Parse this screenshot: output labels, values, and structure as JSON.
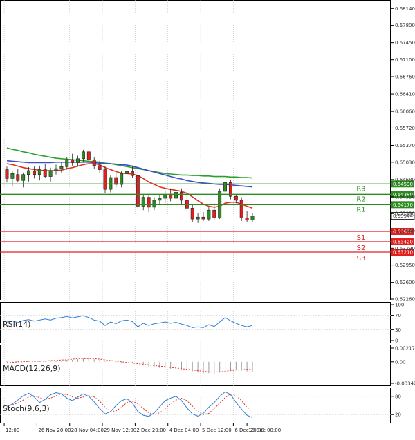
{
  "chart_data": [
    {
      "type": "candlestick",
      "name": "price",
      "ylim": [
        0.6226,
        0.682
      ],
      "y_ticks": [
        "0.68140",
        "0.67800",
        "0.67450",
        "0.67100",
        "0.66760",
        "0.66410",
        "0.66060",
        "0.65720",
        "0.65370",
        "0.65030",
        "0.64680",
        "0.64330",
        "0.63990",
        "0.63640",
        "0.63290",
        "0.62950",
        "0.62600",
        "0.62260"
      ],
      "x_ticks": [
        "12:00",
        "26 Nov 20:00",
        "28 Nov 04:00",
        "29 Nov 12:00",
        "2 Dec 20:00",
        "4 Dec 04:00",
        "5 Dec 12:00",
        "6 Dec 20:00",
        "10 Dec 00:00"
      ],
      "current_price": "0.63944",
      "ohlc": [
        [
          0.6488,
          0.6494,
          0.6462,
          0.647
        ],
        [
          0.647,
          0.6485,
          0.6455,
          0.648
        ],
        [
          0.6478,
          0.649,
          0.6462,
          0.6466
        ],
        [
          0.6466,
          0.6482,
          0.6452,
          0.6478
        ],
        [
          0.6478,
          0.6493,
          0.6464,
          0.6486
        ],
        [
          0.6484,
          0.6494,
          0.647,
          0.6478
        ],
        [
          0.6478,
          0.6496,
          0.6466,
          0.6488
        ],
        [
          0.6488,
          0.65,
          0.6472,
          0.6474
        ],
        [
          0.6474,
          0.6492,
          0.6464,
          0.6486
        ],
        [
          0.6486,
          0.6498,
          0.6478,
          0.649
        ],
        [
          0.649,
          0.6502,
          0.6482,
          0.6494
        ],
        [
          0.6494,
          0.6514,
          0.6488,
          0.6508
        ],
        [
          0.6508,
          0.652,
          0.6496,
          0.6502
        ],
        [
          0.6502,
          0.6516,
          0.6494,
          0.651
        ],
        [
          0.651,
          0.6528,
          0.6502,
          0.6524
        ],
        [
          0.6524,
          0.653,
          0.6502,
          0.6508
        ],
        [
          0.6508,
          0.6514,
          0.649,
          0.6496
        ],
        [
          0.6496,
          0.6506,
          0.6482,
          0.6488
        ],
        [
          0.6488,
          0.6496,
          0.644,
          0.6448
        ],
        [
          0.6448,
          0.6476,
          0.6442,
          0.6472
        ],
        [
          0.6472,
          0.6482,
          0.6452,
          0.6458
        ],
        [
          0.6458,
          0.6486,
          0.6452,
          0.648
        ],
        [
          0.648,
          0.6492,
          0.6468,
          0.6484
        ],
        [
          0.6484,
          0.6496,
          0.6472,
          0.6476
        ],
        [
          0.6476,
          0.6488,
          0.641,
          0.6414
        ],
        [
          0.6414,
          0.6438,
          0.6406,
          0.6432
        ],
        [
          0.6432,
          0.6436,
          0.6402,
          0.6412
        ],
        [
          0.6412,
          0.6432,
          0.6406,
          0.6426
        ],
        [
          0.6426,
          0.6438,
          0.6416,
          0.643
        ],
        [
          0.643,
          0.6446,
          0.642,
          0.6438
        ],
        [
          0.6438,
          0.645,
          0.6424,
          0.643
        ],
        [
          0.643,
          0.6448,
          0.6422,
          0.6442
        ],
        [
          0.6442,
          0.645,
          0.6418,
          0.6426
        ],
        [
          0.6426,
          0.6434,
          0.6404,
          0.641
        ],
        [
          0.641,
          0.6418,
          0.6382,
          0.6388
        ],
        [
          0.6388,
          0.64,
          0.638,
          0.6392
        ],
        [
          0.6392,
          0.6402,
          0.6384,
          0.6388
        ],
        [
          0.6388,
          0.6412,
          0.6384,
          0.6406
        ],
        [
          0.6406,
          0.642,
          0.6386,
          0.639
        ],
        [
          0.639,
          0.645,
          0.6388,
          0.6444
        ],
        [
          0.6444,
          0.6466,
          0.6436,
          0.6462
        ],
        [
          0.6462,
          0.6468,
          0.6428,
          0.6434
        ],
        [
          0.6434,
          0.6438,
          0.642,
          0.6426
        ],
        [
          0.6426,
          0.6432,
          0.6384,
          0.639
        ],
        [
          0.639,
          0.6404,
          0.6382,
          0.6386
        ],
        [
          0.6386,
          0.64,
          0.6382,
          0.6394
        ]
      ],
      "series": [
        {
          "color": "#2ca02c",
          "values": [
            0.6532,
            0.6529,
            0.6527,
            0.6524,
            0.6522,
            0.6519,
            0.6517,
            0.6515,
            0.6513,
            0.6511,
            0.651,
            0.6509,
            0.6508,
            0.6507,
            0.6506,
            0.6505,
            0.6504,
            0.6503,
            0.6501,
            0.65,
            0.6498,
            0.6496,
            0.6494,
            0.6492,
            0.649,
            0.6488,
            0.6486,
            0.6484,
            0.6482,
            0.648,
            0.6479,
            0.6478,
            0.6477,
            0.6477,
            0.6476,
            0.6476,
            0.6475,
            0.6475,
            0.6474,
            0.6474,
            0.6474,
            0.6473,
            0.6473,
            0.6472,
            0.6472,
            0.6471
          ]
        },
        {
          "color": "#3a4fc8",
          "values": [
            0.6506,
            0.6505,
            0.6504,
            0.6503,
            0.6502,
            0.6502,
            0.6502,
            0.6502,
            0.6502,
            0.6503,
            0.6503,
            0.6503,
            0.6503,
            0.6503,
            0.6503,
            0.6503,
            0.6502,
            0.6501,
            0.65,
            0.65,
            0.6499,
            0.6498,
            0.6497,
            0.6495,
            0.6492,
            0.6489,
            0.6486,
            0.6483,
            0.648,
            0.6477,
            0.6474,
            0.6471,
            0.6469,
            0.6466,
            0.6464,
            0.6462,
            0.6461,
            0.646,
            0.6459,
            0.6458,
            0.6458,
            0.6457,
            0.6456,
            0.6455,
            0.6454,
            0.6453
          ]
        },
        {
          "color": "#e03020",
          "values": [
            0.65,
            0.6498,
            0.6495,
            0.6492,
            0.649,
            0.6488,
            0.6487,
            0.6486,
            0.6486,
            0.6486,
            0.6487,
            0.649,
            0.6492,
            0.6495,
            0.6498,
            0.65,
            0.65,
            0.6498,
            0.6492,
            0.6488,
            0.6484,
            0.6481,
            0.648,
            0.6479,
            0.6476,
            0.647,
            0.6463,
            0.6458,
            0.6453,
            0.645,
            0.6448,
            0.6446,
            0.6444,
            0.644,
            0.6433,
            0.6425,
            0.6418,
            0.6414,
            0.6412,
            0.6414,
            0.642,
            0.6422,
            0.6422,
            0.6418,
            0.6414,
            0.641
          ]
        }
      ],
      "levels": [
        {
          "label": "R3",
          "value": "0.64590",
          "color": "#2e8b22"
        },
        {
          "label": "R2",
          "value": "0.64380",
          "color": "#2e8b22"
        },
        {
          "label": "R1",
          "value": "0.64170",
          "color": "#2e8b22"
        },
        {
          "label": "S1",
          "value": "0.63630",
          "color": "#e02020"
        },
        {
          "label": "S2",
          "value": "0.63420",
          "color": "#e02020"
        },
        {
          "label": "S3",
          "value": "0.63210",
          "color": "#e02020"
        }
      ]
    },
    {
      "type": "line",
      "name": "RSI(14)",
      "ylim": [
        0,
        100
      ],
      "y_ticks": [
        "100",
        "70",
        "30",
        "0"
      ],
      "color": "#2a7fd6",
      "values": [
        52,
        55,
        50,
        56,
        58,
        54,
        57,
        60,
        57,
        62,
        64,
        67,
        63,
        66,
        69,
        64,
        57,
        54,
        42,
        52,
        47,
        55,
        57,
        53,
        38,
        48,
        42,
        47,
        49,
        52,
        48,
        51,
        46,
        42,
        36,
        38,
        36,
        44,
        39,
        52,
        64,
        55,
        48,
        42,
        38,
        42
      ]
    },
    {
      "type": "line",
      "name": "MACD(12,26,9)",
      "ylim": [
        -0.003423,
        0.002171
      ],
      "y_ticks": [
        "0.002171",
        "0.00",
        "-0.003423"
      ],
      "series": [
        {
          "kind": "histogram",
          "color": "#9a9a9a",
          "values": [
            0.0002,
            0.0002,
            0.0001,
            0.0001,
            0.0001,
            0.0001,
            0.0001,
            0.0001,
            0.0001,
            0.0002,
            0.0002,
            0.0003,
            0.0003,
            0.0004,
            0.0005,
            0.0005,
            0.0004,
            0.0003,
            0.0001,
            0.0,
            -0.0001,
            -0.0001,
            -0.0001,
            -0.0002,
            -0.0004,
            -0.0006,
            -0.0008,
            -0.0009,
            -0.001,
            -0.001,
            -0.0011,
            -0.0011,
            -0.0012,
            -0.0013,
            -0.0015,
            -0.0017,
            -0.0018,
            -0.0018,
            -0.0019,
            -0.0017,
            -0.0014,
            -0.0013,
            -0.0013,
            -0.0014,
            -0.0015,
            -0.0016
          ]
        },
        {
          "kind": "signal",
          "color": "#e03020",
          "values": [
            -0.0001,
            -0.0001,
            0.0,
            0.0,
            0.0001,
            0.0001,
            0.0001,
            0.0001,
            0.0002,
            0.0002,
            0.0003,
            0.0003,
            0.0004,
            0.0005,
            0.0005,
            0.0005,
            0.0005,
            0.0004,
            0.0003,
            0.0002,
            0.0001,
            0.0,
            -0.0001,
            -0.0002,
            -0.0003,
            -0.0004,
            -0.0005,
            -0.0006,
            -0.0007,
            -0.0008,
            -0.0009,
            -0.001,
            -0.0011,
            -0.0012,
            -0.0013,
            -0.0014,
            -0.0015,
            -0.0016,
            -0.0016,
            -0.0016,
            -0.0015,
            -0.0014,
            -0.0013,
            -0.0013,
            -0.0012,
            -0.0012
          ]
        }
      ]
    },
    {
      "type": "line",
      "name": "Stoch(9,6,3)",
      "ylim": [
        0,
        100
      ],
      "y_ticks": [
        "80",
        "20"
      ],
      "series": [
        {
          "kind": "main",
          "color": "#2a7fd6",
          "values": [
            45,
            55,
            68,
            82,
            90,
            78,
            60,
            70,
            85,
            92,
            88,
            74,
            66,
            78,
            88,
            80,
            62,
            40,
            22,
            30,
            50,
            66,
            72,
            58,
            30,
            18,
            14,
            26,
            46,
            66,
            74,
            80,
            66,
            42,
            22,
            15,
            24,
            44,
            60,
            80,
            95,
            86,
            60,
            38,
            18,
            10
          ]
        },
        {
          "kind": "signal",
          "color": "#e03020",
          "values": [
            50,
            52,
            58,
            68,
            78,
            82,
            76,
            70,
            74,
            82,
            88,
            86,
            78,
            74,
            78,
            82,
            78,
            64,
            44,
            30,
            32,
            44,
            60,
            64,
            56,
            40,
            26,
            20,
            26,
            40,
            56,
            68,
            74,
            66,
            48,
            30,
            20,
            24,
            40,
            58,
            76,
            88,
            82,
            66,
            44,
            26
          ]
        }
      ]
    }
  ]
}
